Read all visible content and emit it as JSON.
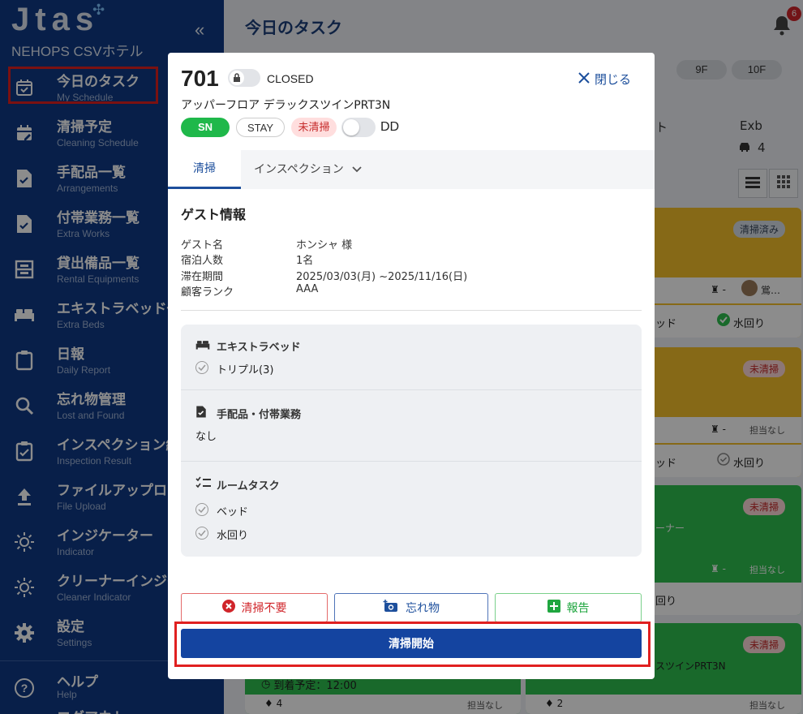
{
  "app": {
    "logo": "Jtas",
    "hotel_name": "NEHOPS CSVホテル",
    "collapse_icon": "double-chevron-left-icon"
  },
  "sidebar": {
    "items": [
      {
        "label": "今日のタスク",
        "sub": "My Schedule",
        "icon": "calendar-check-icon",
        "active": true
      },
      {
        "label": "清掃予定",
        "sub": "Cleaning Schedule",
        "icon": "calendar-edit-icon"
      },
      {
        "label": "手配品一覧",
        "sub": "Arrangements",
        "icon": "document-check-icon"
      },
      {
        "label": "付帯業務一覧",
        "sub": "Extra Works",
        "icon": "document-check-icon"
      },
      {
        "label": "貸出備品一覧",
        "sub": "Rental Equipments",
        "icon": "locker-icon"
      },
      {
        "label": "エキストラベッド一",
        "sub": "Extra Beds",
        "icon": "bed-icon"
      },
      {
        "label": "日報",
        "sub": "Daily Report",
        "icon": "clipboard-icon"
      },
      {
        "label": "忘れ物管理",
        "sub": "Lost and Found",
        "icon": "search-icon"
      },
      {
        "label": "インスペクション結",
        "sub": "Inspection Result",
        "icon": "clipboard-check-icon"
      },
      {
        "label": "ファイルアップロー",
        "sub": "File Upload",
        "icon": "upload-icon"
      },
      {
        "label": "インジケーター",
        "sub": "Indicator",
        "icon": "sun-icon"
      },
      {
        "label": "クリーナーインジケ",
        "sub": "Cleaner Indicator",
        "icon": "sun-icon"
      },
      {
        "label": "設定",
        "sub": "Settings",
        "icon": "gear-icon"
      },
      {
        "label": "ヘルプ",
        "sub": "Help",
        "icon": "help-circle-icon"
      },
      {
        "label": "ログアウト",
        "sub": "",
        "icon": "logout-icon"
      }
    ]
  },
  "main": {
    "title": "今日のタスク",
    "notification_count": "6",
    "floors": [
      "9F",
      "10F"
    ],
    "column_header": "Exb",
    "column_count": "4",
    "column_partial": "ト",
    "cards": [
      {
        "status": "清掃済み",
        "tail1": "ッド",
        "tail2": "水回り",
        "assignee": "鴬…"
      },
      {
        "status": "未清掃",
        "tail1": "ッド",
        "tail2": "水回り",
        "assignee": "担当なし"
      },
      {
        "status": "未清掃",
        "tail1": "回り",
        "partial": "ーナー",
        "assignee": "担当なし"
      },
      {
        "status": "未清掃",
        "partial": "スツインPRT3N"
      }
    ],
    "arrival": "到着予定：12:00",
    "row_counts": [
      "4",
      "2"
    ],
    "dash": "-",
    "unassigned": "担当なし"
  },
  "modal": {
    "room_number": "701",
    "lock_state": "CLOSED",
    "close_label": "閉じる",
    "room_type": "アッパーフロア デラックスツインPRT3N",
    "tags": {
      "sn": "SN",
      "stay": "STAY",
      "status": "未清掃",
      "dd": "DD"
    },
    "tabs": {
      "cleaning": "清掃",
      "inspection": "インスペクション"
    },
    "guest": {
      "title": "ゲスト情報",
      "rows": [
        {
          "k": "ゲスト名",
          "v": "ホンシャ 様"
        },
        {
          "k": "宿泊人数",
          "v": "1名"
        },
        {
          "k": "滞在期間",
          "v": "2025/03/03(月) ~2025/11/16(日)"
        },
        {
          "k": "顧客ランク",
          "v": "AAA"
        }
      ]
    },
    "extra_bed": {
      "title": "エキストラベッド",
      "item": "トリプル(3)"
    },
    "arrangements": {
      "title": "手配品・付帯業務",
      "value": "なし"
    },
    "room_tasks": {
      "title": "ルームタスク",
      "items": [
        "ベッド",
        "水回り"
      ]
    },
    "actions": {
      "no_clean": "清掃不要",
      "lost": "忘れ物",
      "report": "報告"
    },
    "start": "清掃開始"
  },
  "colors": {
    "sidebar": "#0f3a86",
    "primary": "#1444a0",
    "highlight": "#e02020",
    "yellow_card": "#f5c02b",
    "green_card": "#2ebf4f",
    "sn_tag": "#1fb84a"
  }
}
